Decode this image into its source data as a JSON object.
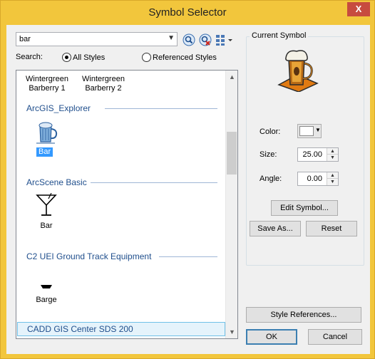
{
  "window": {
    "title": "Symbol Selector",
    "close_glyph": "X"
  },
  "search": {
    "query": "bar",
    "label": "Search:",
    "options": [
      {
        "label": "All Styles",
        "selected": true
      },
      {
        "label": "Referenced Styles",
        "selected": false
      }
    ],
    "icons": [
      "search-icon",
      "clear-search-icon",
      "view-options-icon"
    ]
  },
  "list": {
    "top_items": [
      {
        "line1": "Wintergreen",
        "line2": "Barberry 1"
      },
      {
        "line1": "Wintergreen",
        "line2": "Barberry 2"
      }
    ],
    "categories": [
      {
        "name": "ArcGIS_Explorer",
        "symbol": {
          "label": "Bar",
          "icon": "beer-mug-icon",
          "selected": true
        }
      },
      {
        "name": "ArcScene Basic",
        "symbol": {
          "label": "Bar",
          "icon": "cocktail-glass-icon",
          "selected": false
        }
      },
      {
        "name": "C2 UEI Ground Track Equipment",
        "symbol": {
          "label": "Barge",
          "icon": "barge-icon",
          "selected": false
        }
      },
      {
        "name": "CADD GIS Center SDS 200",
        "symbol": null
      }
    ]
  },
  "current_symbol": {
    "group_title": "Current Symbol",
    "preview_icon": "beer-mug-icon",
    "color_label": "Color:",
    "color_value": "#ffffff",
    "size_label": "Size:",
    "size_value": "25.00",
    "angle_label": "Angle:",
    "angle_value": "0.00"
  },
  "buttons": {
    "edit_symbol": "Edit Symbol...",
    "save_as": "Save As...",
    "reset": "Reset",
    "style_references": "Style References...",
    "ok": "OK",
    "cancel": "Cancel"
  },
  "colors": {
    "title_bar": "#f2c63c",
    "accent": "#3399ff",
    "category_text": "#1f4e8c",
    "close": "#c74b3f"
  }
}
